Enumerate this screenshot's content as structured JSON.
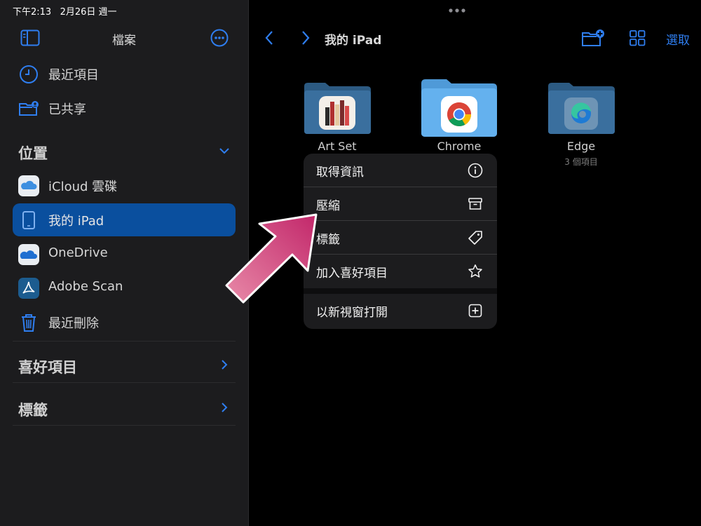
{
  "status_bar": {
    "time": "下午2:13",
    "date": "2月26日 週一"
  },
  "sidebar": {
    "title": "檔案",
    "top_items": [
      {
        "label": "最近項目",
        "icon": "clock-icon"
      },
      {
        "label": "已共享",
        "icon": "shared-folder-icon"
      }
    ],
    "locations_title": "位置",
    "locations": [
      {
        "label": "iCloud 雲碟",
        "icon": "icloud-icon"
      },
      {
        "label": "我的 iPad",
        "icon": "ipad-icon",
        "selected": true
      },
      {
        "label": "OneDrive",
        "icon": "onedrive-icon"
      },
      {
        "label": "Adobe Scan",
        "icon": "adobe-scan-icon"
      },
      {
        "label": "最近刪除",
        "icon": "trash-icon"
      }
    ],
    "favorites_title": "喜好項目",
    "tags_title": "標籤"
  },
  "main": {
    "title": "我的 iPad",
    "select_label": "選取",
    "folders": [
      {
        "name": "Art Set",
        "icon": "art-set-app-icon"
      },
      {
        "name": "Chrome",
        "icon": "chrome-icon"
      },
      {
        "name": "Edge",
        "subtitle": "3 個項目",
        "icon": "edge-icon"
      }
    ]
  },
  "context_menu": {
    "items": [
      {
        "label": "取得資訊",
        "icon": "info-icon"
      },
      {
        "label": "壓縮",
        "icon": "archive-icon"
      },
      {
        "label": "標籤",
        "icon": "tag-icon"
      },
      {
        "label": "加入喜好項目",
        "icon": "star-icon"
      },
      {
        "label": "以新視窗打開",
        "icon": "new-window-icon"
      }
    ]
  },
  "colors": {
    "accent": "#2f7ef0",
    "selected_row": "#0a4f9e",
    "annotation_arrow": "#d23c78"
  }
}
